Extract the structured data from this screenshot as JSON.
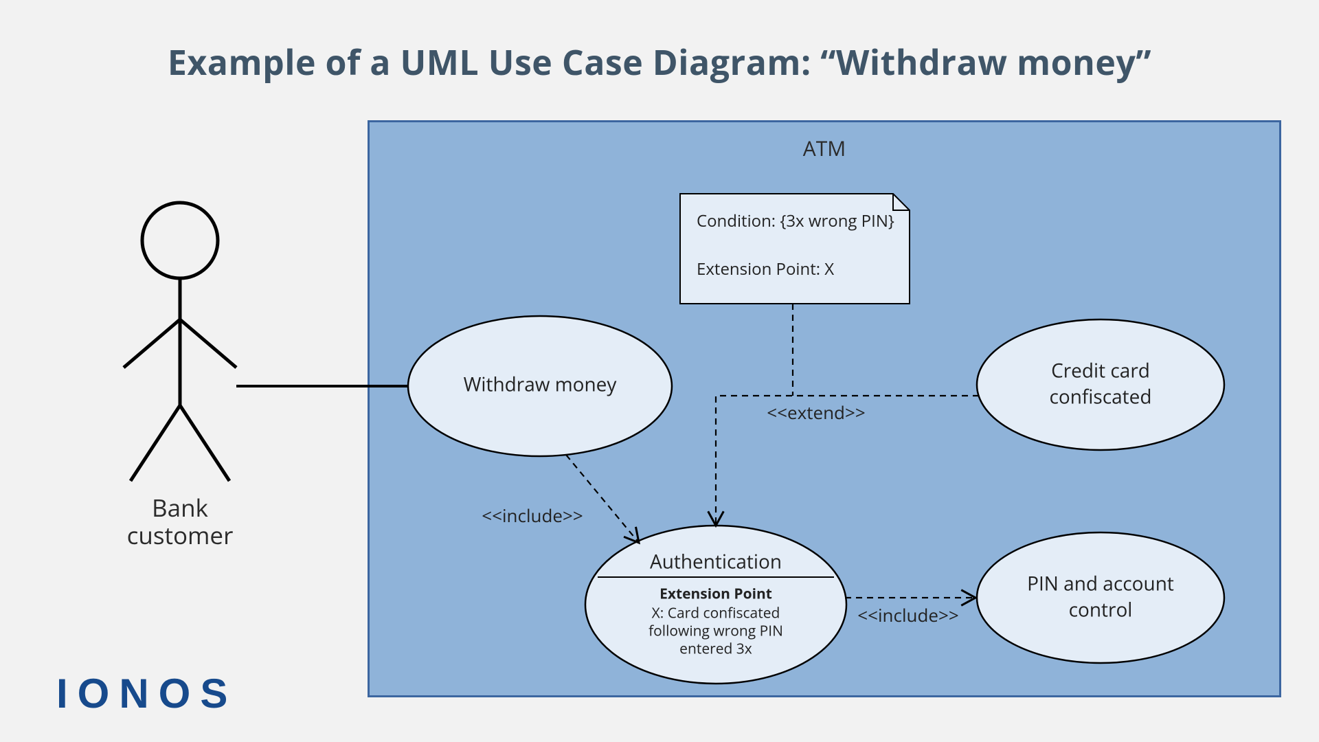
{
  "title": "Example of a UML Use Case Diagram: “Withdraw money”",
  "actor": {
    "label": "Bank\ncustomer"
  },
  "system": {
    "label": "ATM"
  },
  "usecases": {
    "withdraw": {
      "label": "Withdraw money"
    },
    "auth": {
      "label": "Authentication",
      "ext_heading": "Extension Point",
      "ext_line1": "X: Card confiscated",
      "ext_line2": "following wrong PIN",
      "ext_line3": "entered 3x"
    },
    "confiscated": {
      "line1": "Credit card",
      "line2": "confiscated"
    },
    "pincontrol": {
      "line1": "PIN and account",
      "line2": "control"
    }
  },
  "note": {
    "line1": "Condition: {3x wrong PIN}",
    "line2": "Extension Point: X"
  },
  "relations": {
    "include1": "<<include>>",
    "extend": "<<extend>>",
    "include2": "<<include>>"
  },
  "brand": "IONOS"
}
